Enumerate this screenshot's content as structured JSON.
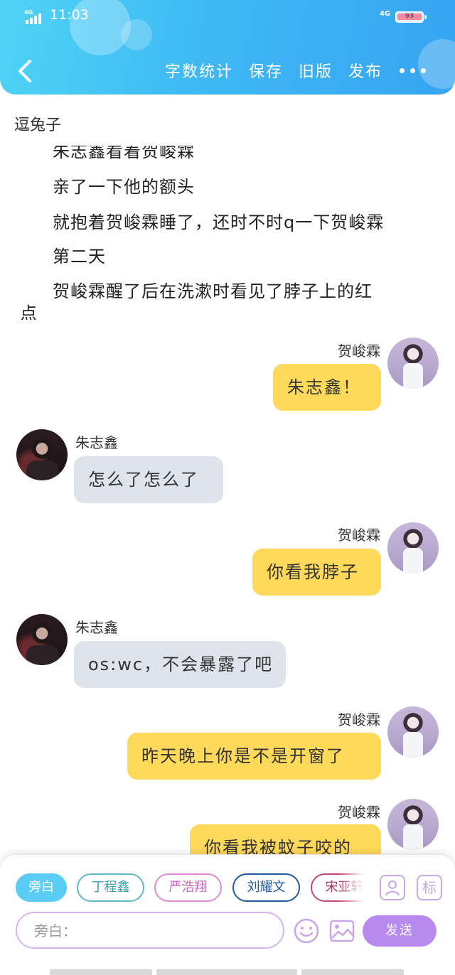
{
  "status_bar": {
    "network_left": "4G",
    "time": "11:03",
    "network_right": "4G",
    "battery": "93"
  },
  "toolbar": {
    "word_count": "字数统计",
    "save": "保存",
    "old_version": "旧版",
    "publish": "发布"
  },
  "story": {
    "title": "逗兔子",
    "narration": [
      "朱志鑫看着贺峻霖",
      "亲了一下他的额头",
      "就抱着贺峻霖睡了，还时不时q一下贺峻霖",
      "第二天",
      "贺峻霖醒了后在洗漱时看见了脖子上的红",
      "点"
    ]
  },
  "messages": [
    {
      "side": "right",
      "speaker": "贺峻霖",
      "text": "朱志鑫！"
    },
    {
      "side": "left",
      "speaker": "朱志鑫",
      "text": "怎么了怎么了"
    },
    {
      "side": "right",
      "speaker": "贺峻霖",
      "text": "你看我脖子"
    },
    {
      "side": "left",
      "speaker": "朱志鑫",
      "text": "os:wc，不会暴露了吧"
    },
    {
      "side": "right",
      "speaker": "贺峻霖",
      "text": "昨天晚上你是不是开窗了"
    },
    {
      "side": "right",
      "speaker": "贺峻霖",
      "text": "你看我被蚊子咬的"
    }
  ],
  "characters": [
    {
      "name": "旁白",
      "color": "#5bcdf5",
      "active": true
    },
    {
      "name": "丁程鑫",
      "color": "#5fb8c8",
      "active": false
    },
    {
      "name": "严浩翔",
      "color": "#e08ad8",
      "active": false
    },
    {
      "name": "刘耀文",
      "color": "#1f5aa0",
      "active": false
    },
    {
      "name": "宋亚轩",
      "color": "#c0457a",
      "active": false
    }
  ],
  "composer": {
    "add_character_icon": "person-icon",
    "label_button": "标",
    "input_placeholder": "旁白：",
    "emoji_icon": "smile-icon",
    "image_icon": "image-icon",
    "send": "发送"
  }
}
